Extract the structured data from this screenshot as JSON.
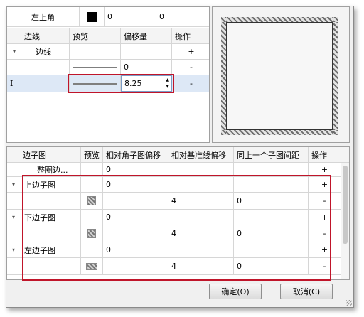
{
  "top_row": {
    "label": "左上角",
    "v1": "0",
    "v2": "0"
  },
  "border_table": {
    "headers": [
      "边线",
      "预览",
      "偏移量",
      "操作"
    ],
    "rows": [
      {
        "name": "边线",
        "offset": "",
        "op": "+"
      },
      {
        "name": "",
        "offset": "0",
        "op": "-"
      },
      {
        "name": "",
        "offset": "8.25",
        "op": "-",
        "indicator": "I"
      }
    ]
  },
  "sub_table": {
    "headers": [
      "边子图",
      "预览",
      "相对角子图偏移",
      "相对基准线偏移",
      "同上一个子图间距",
      "操作"
    ],
    "rows": [
      {
        "name": "整圈边...",
        "a": "0",
        "b": "",
        "c": "",
        "op": "+"
      },
      {
        "name": "上边子图",
        "a": "0",
        "b": "",
        "c": "",
        "op": "+",
        "group": true
      },
      {
        "name": "",
        "a": "",
        "b": "4",
        "c": "0",
        "op": "-"
      },
      {
        "name": "下边子图",
        "a": "0",
        "b": "",
        "c": "",
        "op": "+",
        "group": true
      },
      {
        "name": "",
        "a": "",
        "b": "4",
        "c": "0",
        "op": "-"
      },
      {
        "name": "左边子图",
        "a": "0",
        "b": "",
        "c": "",
        "op": "+",
        "group": true
      },
      {
        "name": "",
        "a": "",
        "b": "4",
        "c": "0",
        "op": "-"
      }
    ]
  },
  "buttons": {
    "ok": "确定(O)",
    "cancel": "取消(C)"
  },
  "spinner": {
    "up": "▲",
    "down": "▼"
  },
  "colors": {
    "highlight": "#c0152a",
    "selected_row": "#dde8f6"
  }
}
